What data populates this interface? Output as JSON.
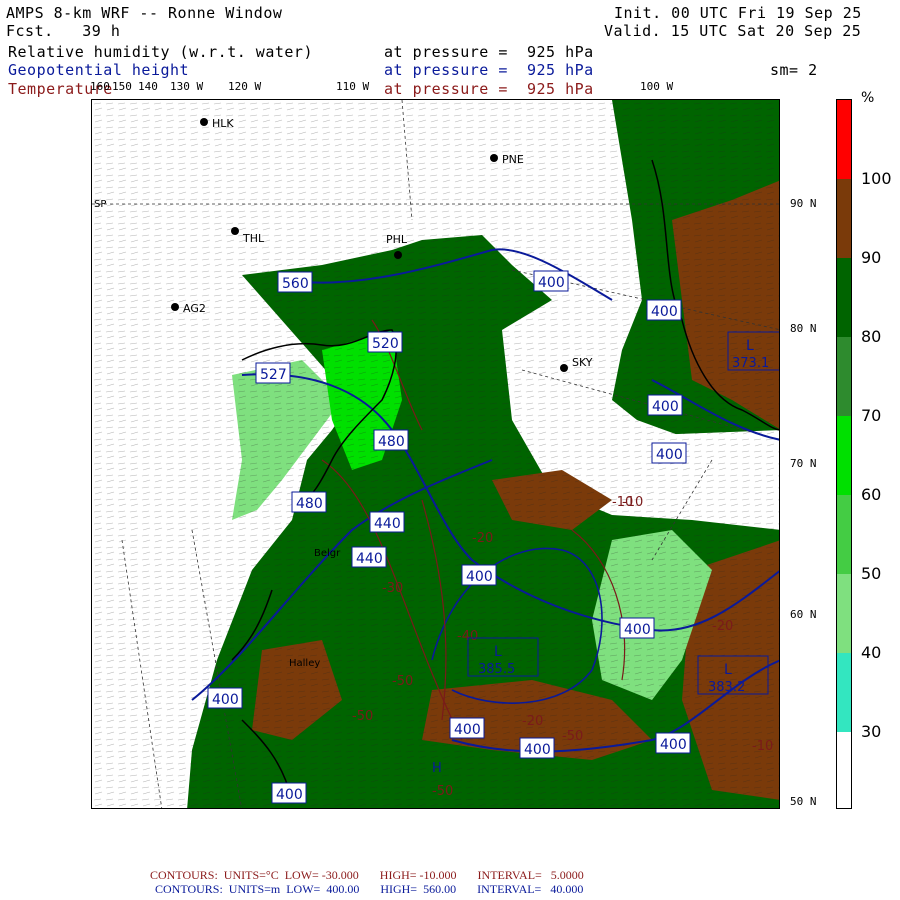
{
  "header": {
    "title": "AMPS 8-km WRF -- Ronne Window",
    "fcst_label": "Fcst.",
    "fcst_value": "39 h",
    "init": "Init. 00 UTC Fri 19 Sep 25",
    "valid": "Valid. 15 UTC Sat 20 Sep 25",
    "fields": [
      {
        "name": "Relative humidity (w.r.t. water)",
        "level": "at pressure =  925 hPa"
      },
      {
        "name": "Geopotential height",
        "level": "at pressure =  925 hPa"
      },
      {
        "name": "Temperature",
        "level": "at pressure =  925 hPa"
      }
    ],
    "sm": "sm= 2"
  },
  "longitude_labels": [
    "160",
    "150",
    "140",
    "130 W",
    "120 W",
    "110 W",
    "100 W"
  ],
  "latitude_labels": [
    "90 N",
    "80 N",
    "70 N",
    "60 N",
    "50 N"
  ],
  "sp_label": "SP",
  "stations": [
    "HLK",
    "PNE",
    "THL",
    "PHL",
    "AG2",
    "SKY",
    "Belgr",
    "Halley"
  ],
  "height_contour_labels": [
    "560",
    "520",
    "527",
    "480",
    "440",
    "400",
    "480",
    "440",
    "400",
    "400",
    "400",
    "400",
    "400",
    "400",
    "400",
    "400",
    "400",
    "400"
  ],
  "temp_contour_labels": [
    "-10",
    "-20",
    "-30",
    "-40",
    "-50",
    "-50",
    "-50",
    "-50",
    "-20",
    "-10",
    "-10",
    "-20"
  ],
  "lows": [
    {
      "letter": "L",
      "value": "385.5"
    },
    {
      "letter": "L",
      "value": "383.2"
    },
    {
      "letter": "L",
      "value": "373.1"
    }
  ],
  "extra_labels": [
    "H",
    "L",
    "L"
  ],
  "colorbar": {
    "unit": "%",
    "labels": [
      "100",
      "90",
      "80",
      "70",
      "60",
      "50",
      "40",
      "30"
    ],
    "colors": [
      "#ff0000",
      "#7a3a0a",
      "#006400",
      "#2e8b2e",
      "#00e000",
      "#44cc44",
      "#7fe07f",
      "#33e6c0",
      "#ffffff"
    ]
  },
  "footer": {
    "temp_contours": "CONTOURS:  UNITS=°C  LOW= -30.000       HIGH= -10.000       INTERVAL=   5.0000",
    "height_contours": "CONTOURS:  UNITS=m  LOW=  400.00       HIGH=  560.00       INTERVAL=   40.000"
  }
}
